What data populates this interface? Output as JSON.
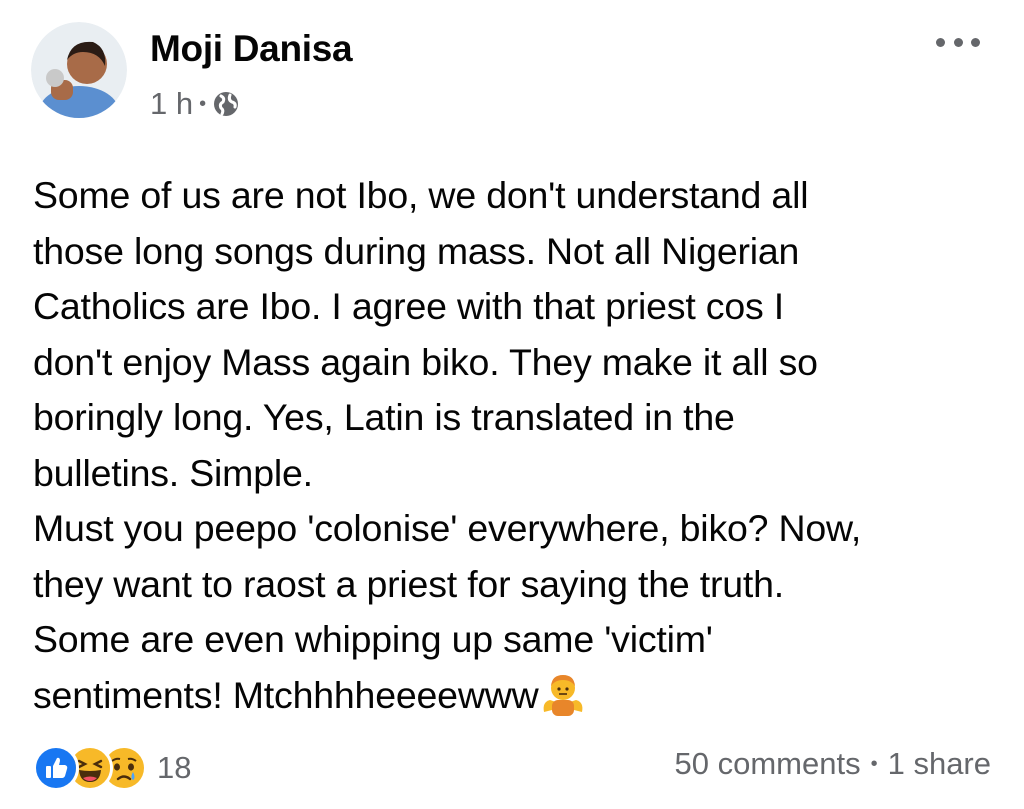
{
  "post": {
    "author": "Moji Danisa",
    "time": "1 h",
    "dot": "•",
    "privacy_icon": "globe-icon",
    "more_icon": "more-options-icon",
    "lines": [
      "Some of us are not Ibo, we don't understand all",
      "those long songs during mass. Not all Nigerian",
      "Catholics are Ibo. I agree with that priest cos I",
      "don't enjoy Mass again biko. They make it all so",
      "boringly long. Yes, Latin is translated in the",
      "bulletins. Simple.",
      "Must you peepo 'colonise' everywhere, biko? Now,",
      "they want to raost a priest for saying the truth.",
      "Some are even whipping up same 'victim'",
      "sentiments!  Mtchhhheeeewww"
    ],
    "trailing_emoji": "person-shrugging-emoji"
  },
  "footer": {
    "reaction_icons": [
      "like-icon",
      "haha-icon",
      "sad-icon"
    ],
    "reaction_count": "18",
    "comments": "50 comments",
    "sep": "•",
    "shares": "1 share"
  },
  "colors": {
    "text": "#050505",
    "secondary": "#65676b",
    "like_blue": "#1877f2",
    "emoji_yellow": "#f7b928"
  }
}
